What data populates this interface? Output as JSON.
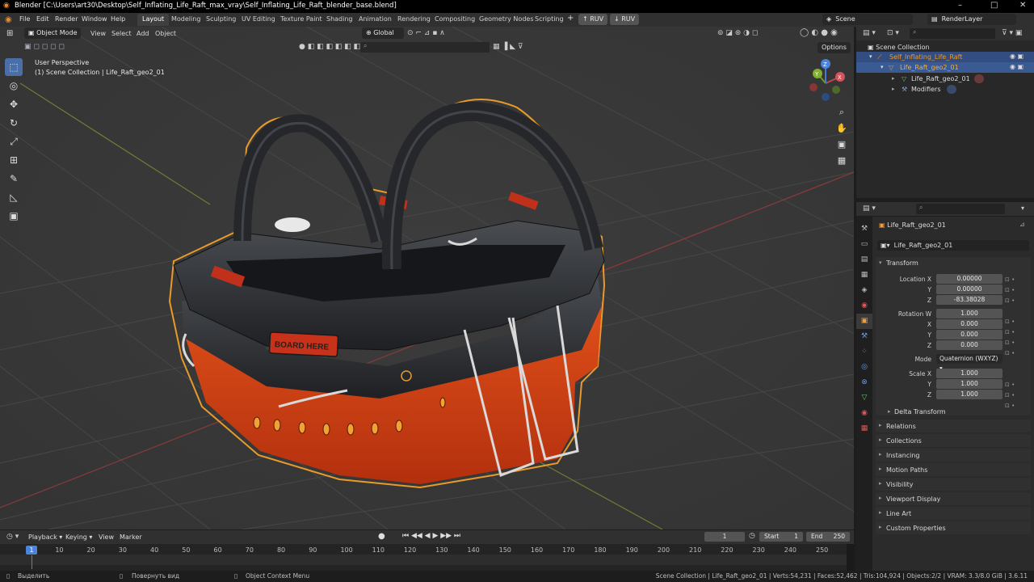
{
  "window": {
    "title": "Blender [C:\\Users\\art30\\Desktop\\Self_Inflating_Life_Raft_max_vray\\Self_Inflating_Life_Raft_blender_base.blend]",
    "controls": [
      "–",
      "□",
      "✕"
    ]
  },
  "menu": [
    "File",
    "Edit",
    "Render",
    "Window",
    "Help"
  ],
  "workspaces": [
    "Layout",
    "Modeling",
    "Sculpting",
    "UV Editing",
    "Texture Paint",
    "Shading",
    "Animation",
    "Rendering",
    "Compositing",
    "Geometry Nodes",
    "Scripting"
  ],
  "workspace_add": "+",
  "ruv_buttons": [
    "RUV",
    "RUV"
  ],
  "scene": {
    "name": "Scene",
    "view_layer": "RenderLayer"
  },
  "viewport_header": {
    "mode": "Object Mode",
    "menus": [
      "View",
      "Select",
      "Add",
      "Object"
    ],
    "transform_orientation": "Global",
    "options": "Options"
  },
  "viewport": {
    "perspective": "User Perspective",
    "collection_info": "(1) Scene Collection | Life_Raft_geo2_01",
    "gizmo_axes": [
      "X",
      "Y",
      "Z"
    ],
    "label_on_model": "BOARD HERE",
    "colors": {
      "raft_red": "#c83a12",
      "raft_black": "#2a2c2f",
      "outline": "#e89a2b",
      "grid": "#474747"
    }
  },
  "toolbar": {
    "tools": [
      "select-box-icon",
      "cursor-icon",
      "move-icon",
      "rotate-icon",
      "scale-icon",
      "transform-icon",
      "annotate-icon",
      "measure-icon",
      "add-cube-icon"
    ]
  },
  "outliner": {
    "root": "Scene Collection",
    "items": [
      {
        "label": "Self_Inflating_Life_Raft",
        "level": 1
      },
      {
        "label": "Life_Raft_geo2_01",
        "level": 2
      },
      {
        "label": "Life_Raft_geo2_01",
        "level": 3
      },
      {
        "label": "Modifiers",
        "level": 3
      }
    ]
  },
  "properties": {
    "object_name": "Life_Raft_geo2_01",
    "datablock_name": "Life_Raft_geo2_01",
    "transform": {
      "header": "Transform",
      "location_label": "Location X",
      "location": [
        "0.00000",
        "0.00000",
        "-83.38028"
      ],
      "rotation_label": "Rotation W",
      "rotation": [
        "1.000",
        "0.000",
        "0.000",
        "0.000"
      ],
      "mode_label": "Mode",
      "mode": "Quaternion (WXYZ)",
      "scale_label": "Scale X",
      "scale": [
        "1.000",
        "1.000",
        "1.000"
      ],
      "axis_y": "Y",
      "axis_z": "Z",
      "axis_x": "X",
      "delta": "Delta Transform"
    },
    "panels": [
      "Relations",
      "Collections",
      "Instancing",
      "Motion Paths",
      "Visibility",
      "Viewport Display",
      "Line Art",
      "Custom Properties"
    ]
  },
  "timeline": {
    "menus": [
      "Playback",
      "Keying",
      "View",
      "Marker"
    ],
    "current_frame": "1",
    "start_label": "Start",
    "start": "1",
    "end_label": "End",
    "end": "250",
    "ticks": [
      "10",
      "20",
      "30",
      "40",
      "50",
      "60",
      "70",
      "80",
      "90",
      "100",
      "110",
      "120",
      "130",
      "140",
      "150",
      "160",
      "170",
      "180",
      "190",
      "200",
      "210",
      "220",
      "230",
      "240",
      "250"
    ],
    "playhead": "1"
  },
  "status": {
    "select": "Выделить",
    "rotate": "Повернуть вид",
    "context": "Object Context Menu",
    "stats": "Scene Collection | Life_Raft_geo2_01 | Verts:54,231 | Faces:52,462 | Tris:104,924 | Objects:2/2 | VRAM: 3.3/8.0 GiB | 3.6.11"
  }
}
